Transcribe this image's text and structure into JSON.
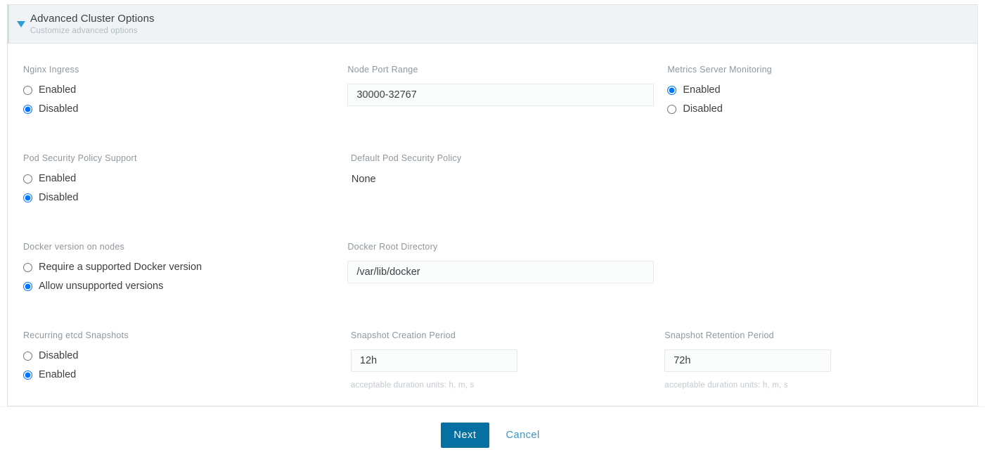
{
  "section": {
    "title": "Advanced Cluster Options",
    "subtitle": "Customize advanced options",
    "toggle_icon": "chevron-down-icon",
    "expanded": true,
    "accent_color": "#2e9fd6",
    "header_bg": "#eff3f5"
  },
  "fields": {
    "nginx_ingress": {
      "label": "Nginx Ingress",
      "options": [
        "Enabled",
        "Disabled"
      ],
      "selected": "Disabled"
    },
    "node_port_range": {
      "label": "Node Port Range",
      "value": "30000-32767"
    },
    "metrics_server_monitoring": {
      "label": "Metrics Server Monitoring",
      "options": [
        "Enabled",
        "Disabled"
      ],
      "selected": "Enabled"
    },
    "pod_security_policy_support": {
      "label": "Pod Security Policy Support",
      "options": [
        "Enabled",
        "Disabled"
      ],
      "selected": "Disabled"
    },
    "default_pod_security_policy": {
      "label": "Default Pod Security Policy",
      "value": "None"
    },
    "docker_version_on_nodes": {
      "label": "Docker version on nodes",
      "options": [
        "Require a supported Docker version",
        "Allow unsupported versions"
      ],
      "selected": "Allow unsupported versions"
    },
    "docker_root_directory": {
      "label": "Docker Root Directory",
      "value": "/var/lib/docker"
    },
    "recurring_etcd_snapshots": {
      "label": "Recurring etcd Snapshots",
      "options": [
        "Disabled",
        "Enabled"
      ],
      "selected": "Enabled"
    },
    "snapshot_creation_period": {
      "label": "Snapshot Creation Period",
      "value": "12h",
      "hint": "acceptable duration units: h, m, s"
    },
    "snapshot_retention_period": {
      "label": "Snapshot Retention Period",
      "value": "72h",
      "hint": "acceptable duration units: h, m, s"
    }
  },
  "footer": {
    "next_label": "Next",
    "cancel_label": "Cancel",
    "primary_color": "#0670a3",
    "link_color": "#3996c9"
  }
}
